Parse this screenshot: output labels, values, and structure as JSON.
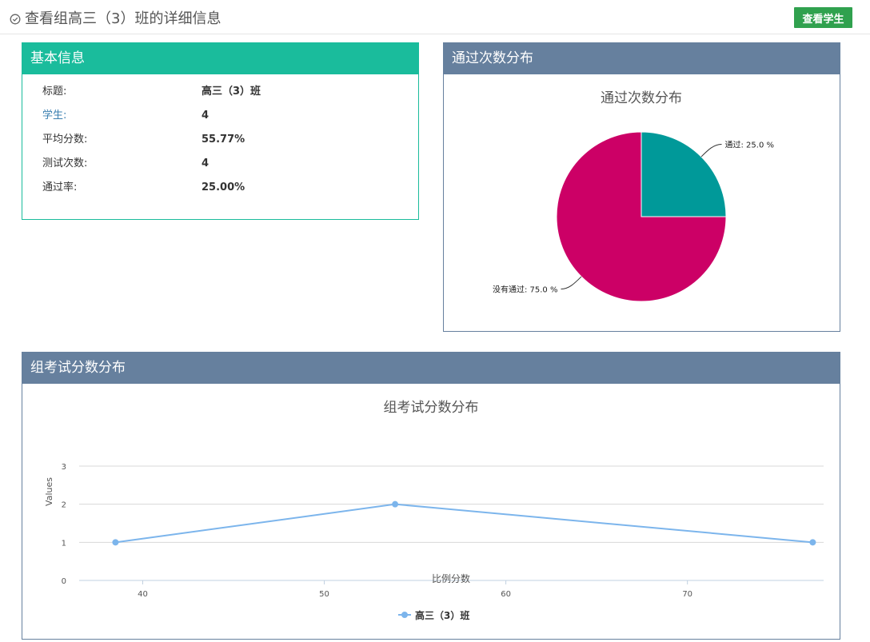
{
  "header": {
    "title": "查看组高三（3）班的详细信息",
    "view_students_label": "查看学生"
  },
  "basic_info": {
    "heading": "基本信息",
    "rows": [
      {
        "label": "标题:",
        "value": "高三（3）班"
      },
      {
        "label": "学生:",
        "value": "4"
      },
      {
        "label": "平均分数:",
        "value": "55.77%"
      },
      {
        "label": "测试次数:",
        "value": "4"
      },
      {
        "label": "通过率:",
        "value": "25.00%"
      }
    ]
  },
  "pass_panel": {
    "heading": "通过次数分布"
  },
  "dist_panel": {
    "heading": "组考试分数分布"
  },
  "colors": {
    "teal": "#1abc9c",
    "slate": "#66809e",
    "green_button": "#30a14e",
    "pie_pass": "#009999",
    "pie_fail": "#cc0066",
    "line": "#7cb5ec"
  },
  "chart_data": [
    {
      "type": "pie",
      "title": "通过次数分布",
      "slices": [
        {
          "label": "通过",
          "value": 25.0,
          "display": "通过: 25.0 %",
          "color": "#009999"
        },
        {
          "label": "没有通过",
          "value": 75.0,
          "display": "没有通过: 75.0 %",
          "color": "#cc0066"
        }
      ]
    },
    {
      "type": "line",
      "title": "组考试分数分布",
      "xlabel": "比例分数",
      "ylabel": "Values",
      "xlim": [
        36.5,
        77.5
      ],
      "ylim": [
        0,
        3
      ],
      "xticks": [
        40,
        50,
        60,
        70
      ],
      "yticks": [
        0,
        1,
        2,
        3
      ],
      "grid": true,
      "legend": "bottom-center",
      "series": [
        {
          "name": "高三（3）班",
          "x": [
            38.5,
            53.9,
            76.9
          ],
          "y": [
            1,
            2,
            1
          ],
          "color": "#7cb5ec"
        }
      ]
    }
  ]
}
